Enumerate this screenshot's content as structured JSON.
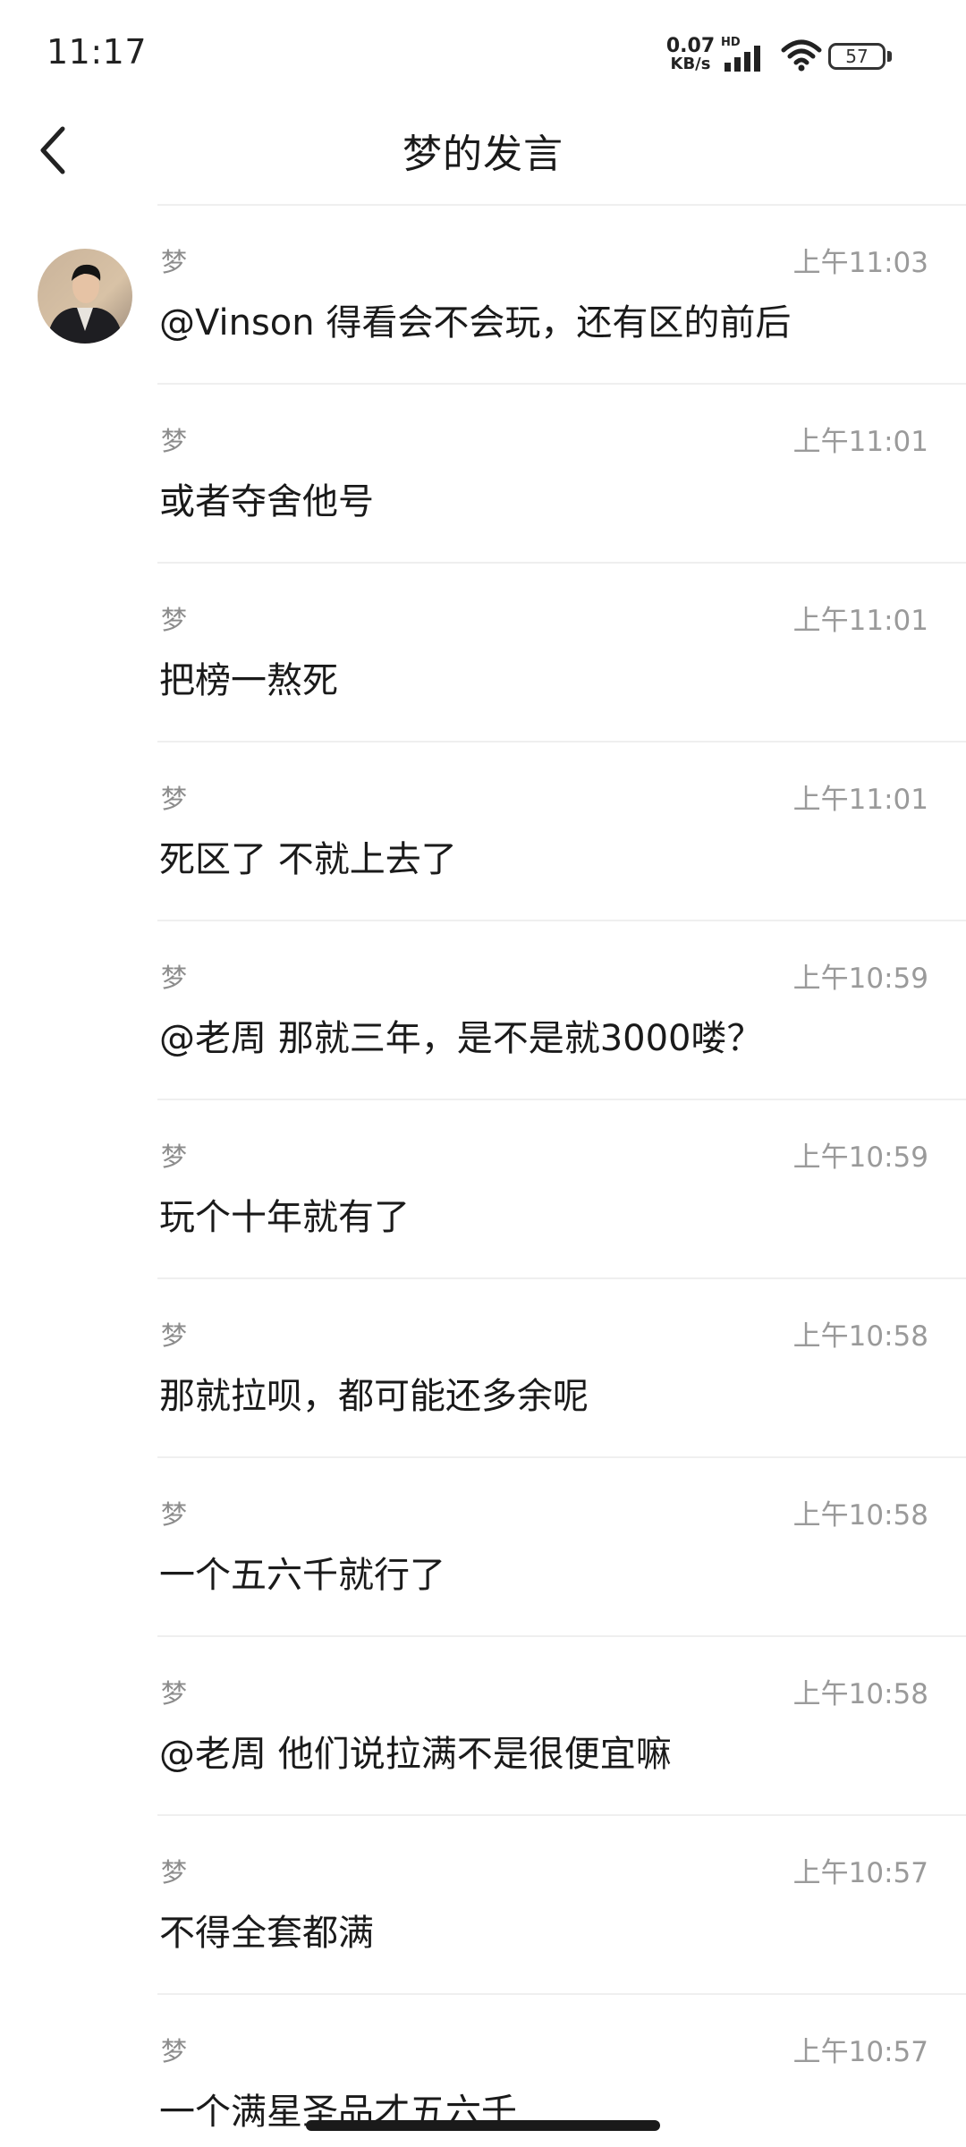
{
  "status_bar": {
    "time": "11:17",
    "net_speed_value": "0.07",
    "net_speed_unit": "KB/s",
    "hd": "HD",
    "battery": "57"
  },
  "header": {
    "title": "梦的发言",
    "back_icon": "chevron-left-icon"
  },
  "messages": [
    {
      "sender": "梦",
      "time": "上午11:03",
      "text": "@Vinson 得看会不会玩，还有区的前后"
    },
    {
      "sender": "梦",
      "time": "上午11:01",
      "text": "或者夺舍他号"
    },
    {
      "sender": "梦",
      "time": "上午11:01",
      "text": "把榜一熬死"
    },
    {
      "sender": "梦",
      "time": "上午11:01",
      "text": "死区了 不就上去了"
    },
    {
      "sender": "梦",
      "time": "上午10:59",
      "text": "@老周 那就三年，是不是就3000喽？"
    },
    {
      "sender": "梦",
      "time": "上午10:59",
      "text": "玩个十年就有了"
    },
    {
      "sender": "梦",
      "time": "上午10:58",
      "text": "那就拉呗，都可能还多余呢"
    },
    {
      "sender": "梦",
      "time": "上午10:58",
      "text": "一个五六千就行了"
    },
    {
      "sender": "梦",
      "time": "上午10:58",
      "text": "@老周 他们说拉满不是很便宜嘛"
    },
    {
      "sender": "梦",
      "time": "上午10:57",
      "text": "不得全套都满"
    },
    {
      "sender": "梦",
      "time": "上午10:57",
      "text": "一个满星圣品才五六千"
    }
  ]
}
